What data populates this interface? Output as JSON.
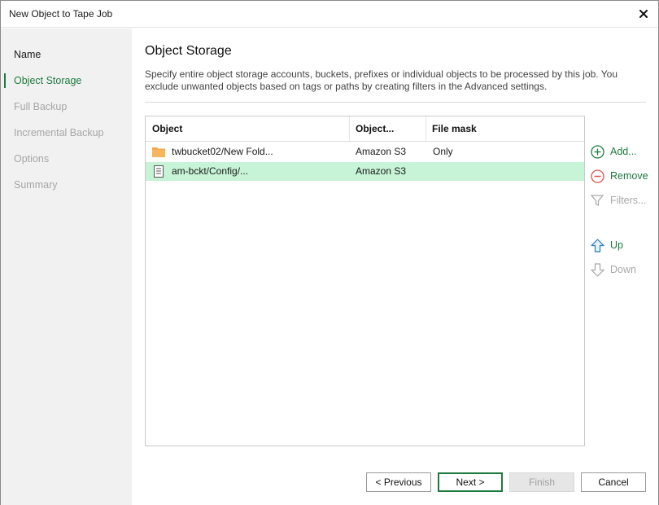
{
  "window": {
    "title": "New Object to Tape Job",
    "close_icon": "close-icon"
  },
  "sidebar": {
    "steps": [
      {
        "label": "Name",
        "state": "done"
      },
      {
        "label": "Object Storage",
        "state": "active"
      },
      {
        "label": "Full Backup",
        "state": "disabled"
      },
      {
        "label": "Incremental Backup",
        "state": "disabled"
      },
      {
        "label": "Options",
        "state": "disabled"
      },
      {
        "label": "Summary",
        "state": "disabled"
      }
    ]
  },
  "main": {
    "title": "Object Storage",
    "description": "Specify entire object storage accounts, buckets, prefixes or individual objects to be processed by this job. You exclude unwanted objects based on tags or paths by creating filters in the Advanced settings."
  },
  "grid": {
    "columns": [
      "Object",
      "Object...",
      "File mask"
    ],
    "rows": [
      {
        "icon": "folder-icon",
        "object": "twbucket02/New Fold...",
        "type": "Amazon S3",
        "mask": "Only",
        "selected": false
      },
      {
        "icon": "document-icon",
        "object": "am-bckt/Config/...",
        "type": "Amazon S3",
        "mask": "",
        "selected": true
      }
    ]
  },
  "actions": {
    "add": "Add...",
    "remove": "Remove",
    "filters": "Filters...",
    "up": "Up",
    "down": "Down"
  },
  "buttons": {
    "previous": "< Previous",
    "next": "Next >",
    "finish": "Finish",
    "cancel": "Cancel"
  },
  "colors": {
    "accent": "#1c7a3d",
    "selection": "#c7f3d6",
    "sidebar_bg": "#f1f1f1",
    "folder": "#f4a84a",
    "remove": "#d9534f"
  }
}
